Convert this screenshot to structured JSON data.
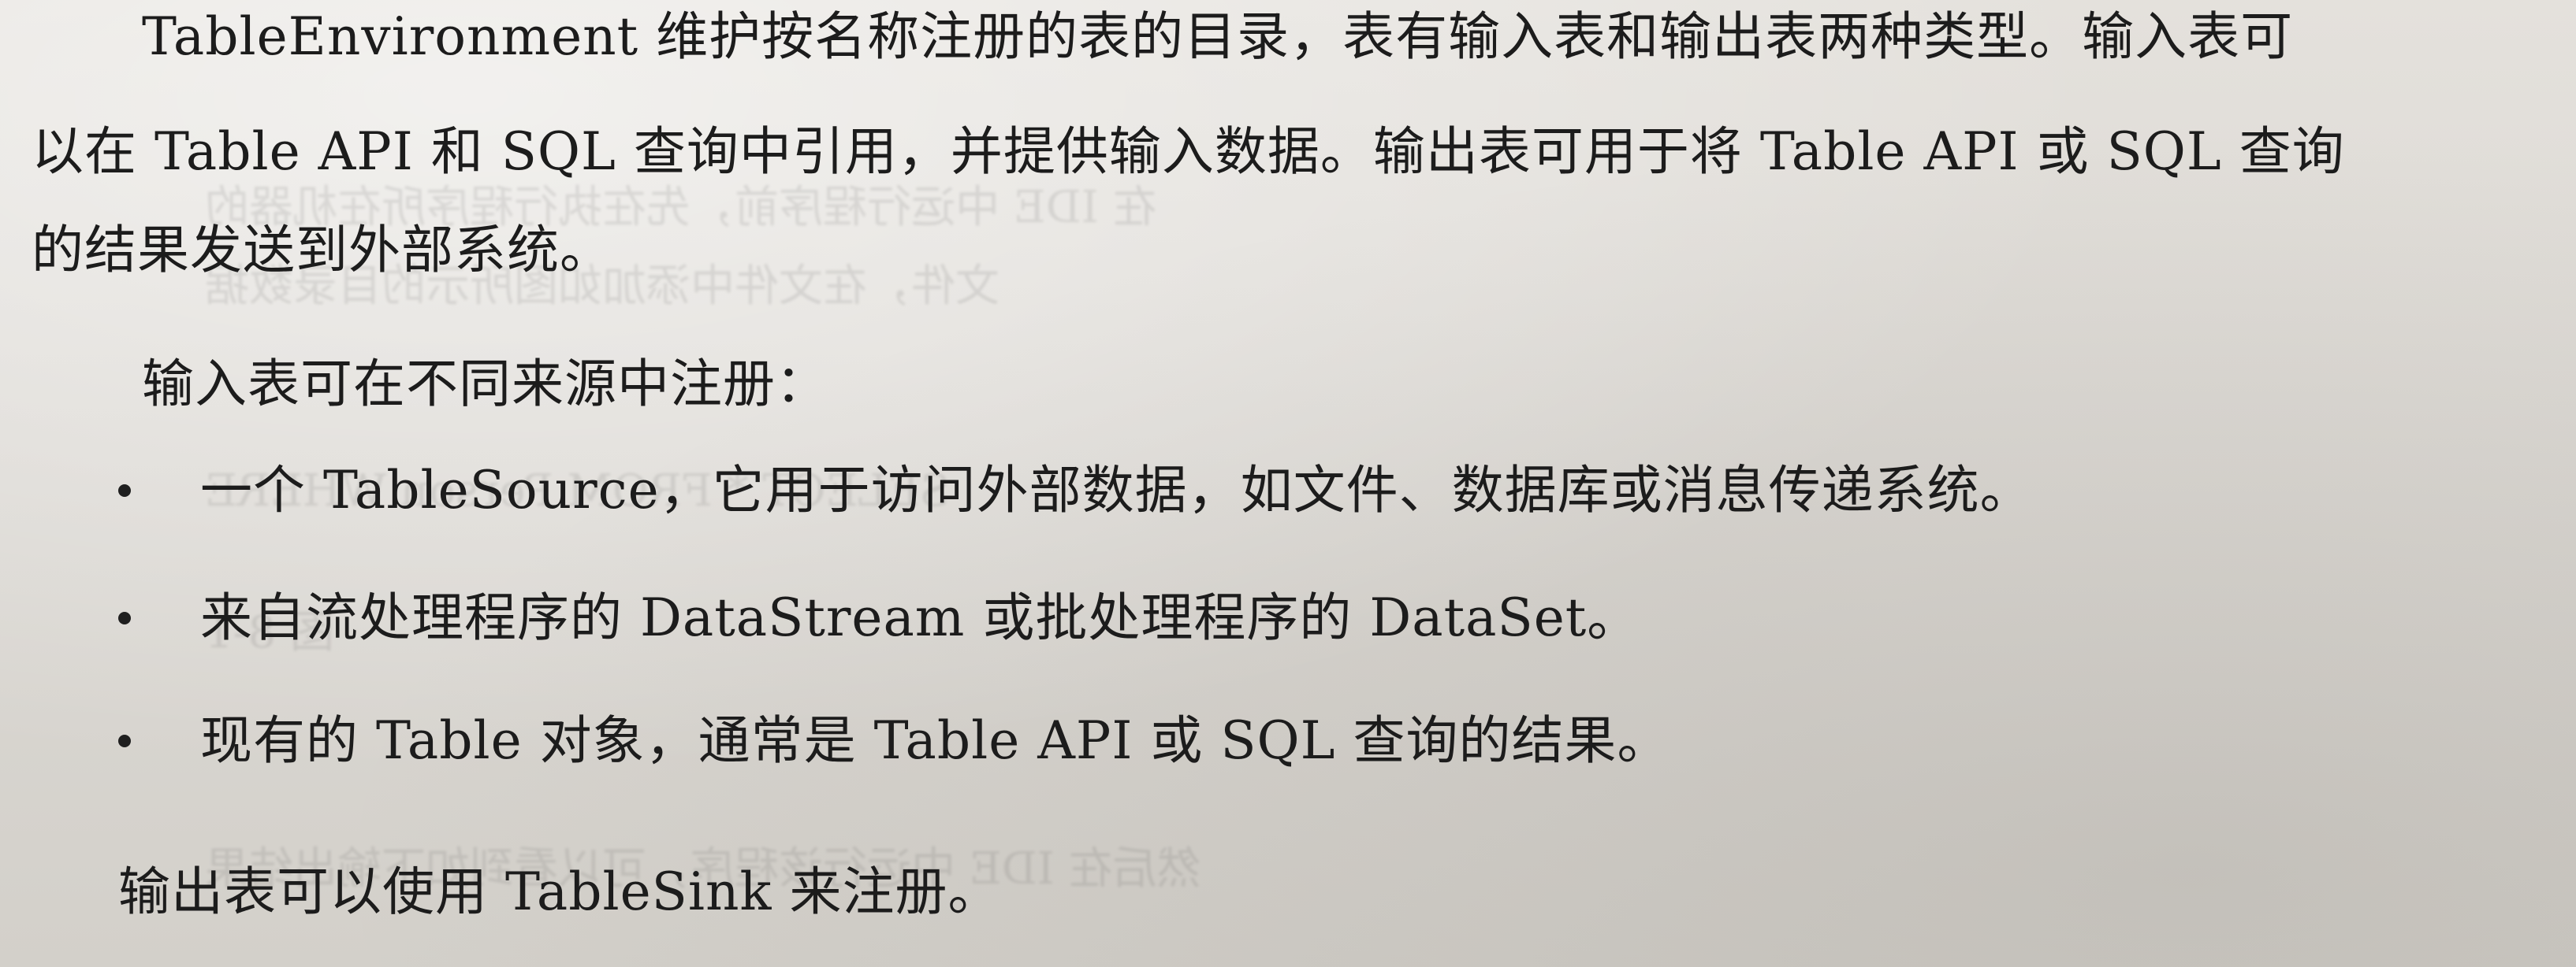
{
  "paragraph1": {
    "line1": "TableEnvironment 维护按名称注册的表的目录，表有输入表和输出表两种类型。输入表可",
    "line2": "以在 Table API 和 SQL 查询中引用，并提供输入数据。输出表可用于将 Table API 或 SQL 查询",
    "line3": "的结果发送到外部系统。"
  },
  "intro": "输入表可在不同来源中注册：",
  "bullets": [
    "一个 TableSource，它用于访问外部数据，如文件、数据库或消息传递系统。",
    "来自流处理程序的 DataStream 或批处理程序的 DataSet。",
    "现有的 Table 对象，通常是 Table API 或 SQL 查询的结果。"
  ],
  "closing": "输出表可以使用 TableSink 来注册。"
}
